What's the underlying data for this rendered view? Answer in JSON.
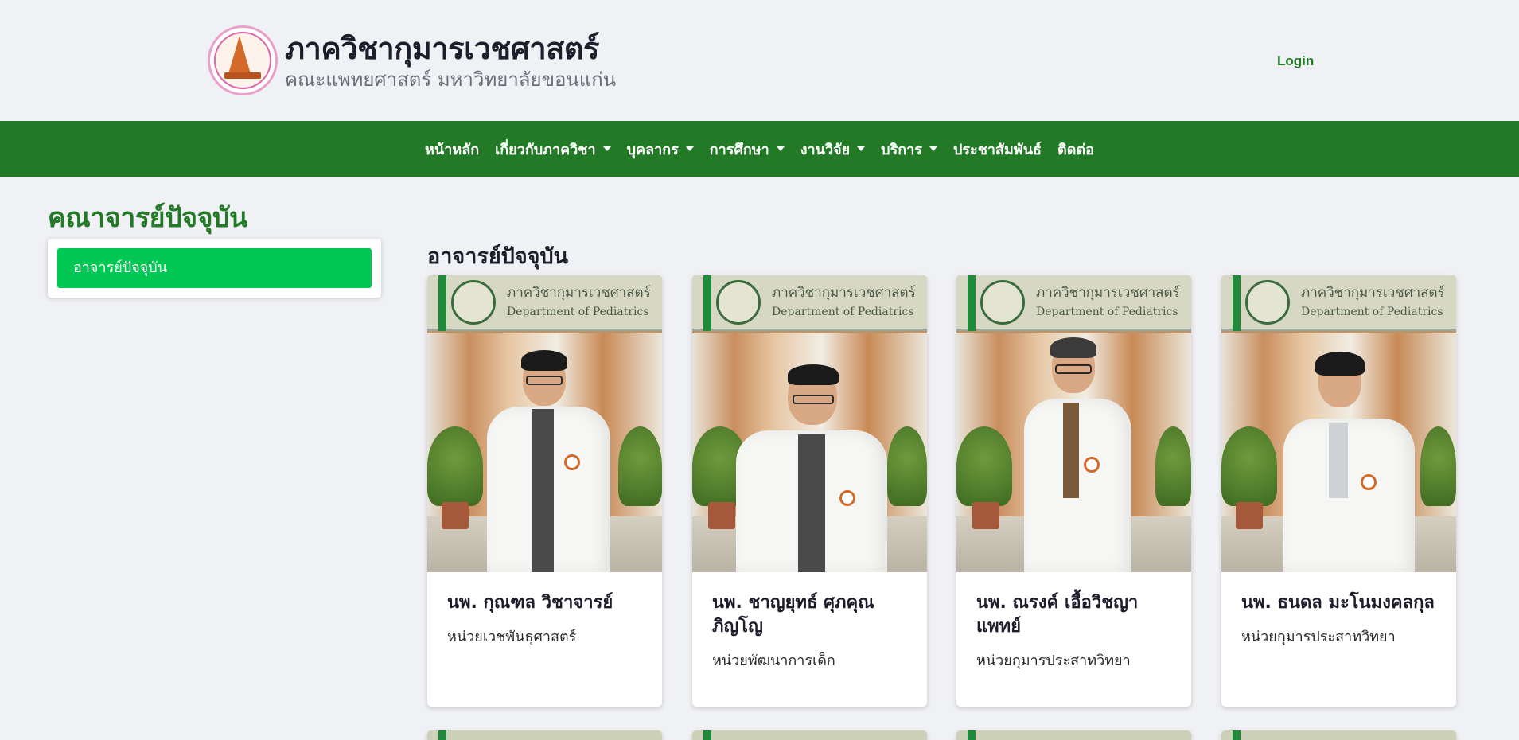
{
  "header": {
    "title": "ภาควิชากุมารเวชศาสตร์",
    "subtitle": "คณะแพทยศาสตร์ มหาวิทยาลัยขอนแก่น",
    "login_label": "Login"
  },
  "nav": {
    "items": [
      {
        "label": "หน้าหลัก",
        "dropdown": false
      },
      {
        "label": "เกี่ยวกับภาควิชา",
        "dropdown": true
      },
      {
        "label": "บุคลากร",
        "dropdown": true
      },
      {
        "label": "การศึกษา",
        "dropdown": true
      },
      {
        "label": "งานวิจัย",
        "dropdown": true
      },
      {
        "label": "บริการ",
        "dropdown": true
      },
      {
        "label": "ประชาสัมพันธ์",
        "dropdown": false
      },
      {
        "label": "ติดต่อ",
        "dropdown": false
      }
    ]
  },
  "page": {
    "title": "คณาจารย์ปัจจุบัน",
    "sidebar": {
      "items": [
        {
          "label": "อาจารย์ปัจจุบัน",
          "active": true
        }
      ]
    },
    "section_title": "อาจารย์ปัจจุบัน"
  },
  "photo_sign": {
    "thai": "ภาควิชากุมารเวชศาสตร์",
    "english": "Department of Pediatrics"
  },
  "cards": [
    {
      "name": "นพ. กุณฑล วิชาจารย์",
      "unit": "หน่วยเวชพันธุศาสตร์"
    },
    {
      "name": "นพ. ชาญยุทธ์ ศุภคุณภิญโญ",
      "unit": "หน่วยพัฒนาการเด็ก"
    },
    {
      "name": "นพ. ณรงค์ เอื้อวิชญาแพทย์",
      "unit": "หน่วยกุมารประสาทวิทยา"
    },
    {
      "name": "นพ. ธนดล มะโนมงคลกุล",
      "unit": "หน่วยกุมารประสาทวิทยา"
    }
  ],
  "colors": {
    "brand_green": "#237a26",
    "active_green": "#00c853",
    "background": "#f0f1f4"
  }
}
